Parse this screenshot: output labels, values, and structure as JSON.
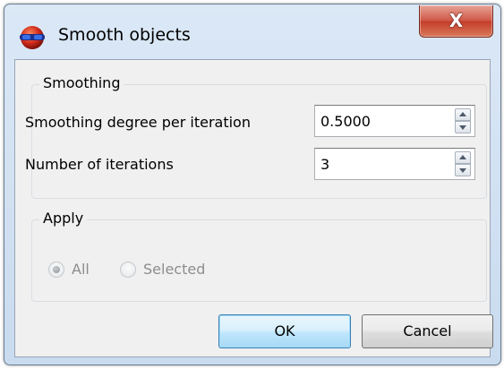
{
  "window": {
    "title": "Smooth objects",
    "close_label": "X"
  },
  "smoothing": {
    "group_title": "Smoothing",
    "degree_label": "Smoothing degree per iteration",
    "degree_value": "0.5000",
    "iterations_label": "Number of iterations",
    "iterations_value": "3"
  },
  "apply": {
    "group_title": "Apply",
    "options": [
      {
        "label": "All",
        "selected": true,
        "enabled": false
      },
      {
        "label": "Selected",
        "selected": false,
        "enabled": false
      }
    ]
  },
  "buttons": {
    "ok_label": "OK",
    "cancel_label": "Cancel"
  },
  "icons": {
    "app": "app-logo-icon",
    "close": "close-icon",
    "spin_up": "spin-up-arrow-icon",
    "spin_down": "spin-down-arrow-icon"
  },
  "colors": {
    "title_bar": "#c9dbef",
    "close_button": "#c53e2c",
    "dialog_background": "#f0f0f0",
    "default_button_border": "#3c7fb1",
    "disabled_text": "#8d8d8d"
  }
}
